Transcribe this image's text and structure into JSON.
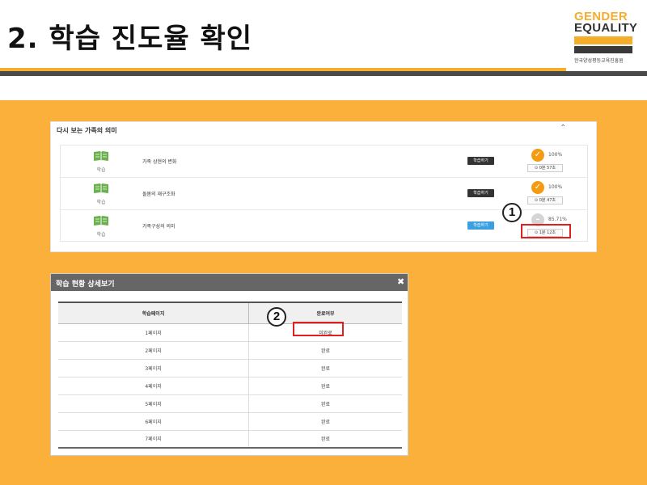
{
  "slide": {
    "title": "2. 학습 진도율 확인"
  },
  "logo": {
    "line1": "GENDER",
    "line2": "EQUALITY",
    "org": "한국양성평등교육진흥원"
  },
  "colors": {
    "accent": "#fbb03b",
    "dark_bar": "#4a4a4a",
    "check": "#f39c12",
    "study_button_dark": "#333333",
    "study_button_active": "#3aa0e0",
    "highlight_box": "#e02020"
  },
  "panel": {
    "title": "다시 보는 가족의 의미",
    "toggle_icon": "chevron-up-icon",
    "toggle_glyph": "⌃",
    "rows": [
      {
        "icon": "book-icon",
        "label": "학습",
        "title": "가족 상현의 변화",
        "button_label": "학습하기",
        "button_style": "dark",
        "status": "complete",
        "status_glyph": "✓",
        "percent": "100%",
        "time": "0분 57초"
      },
      {
        "icon": "book-icon",
        "label": "학습",
        "title": "돌봄의 재구조화",
        "button_label": "학습하기",
        "button_style": "dark",
        "status": "complete",
        "status_glyph": "✓",
        "percent": "100%",
        "time": "0분 47초"
      },
      {
        "icon": "book-icon",
        "label": "학습",
        "title": "가족구성의 의미",
        "button_label": "학습하기",
        "button_style": "active",
        "status": "incomplete",
        "status_glyph": "–",
        "percent": "85.71%",
        "time": "1분 12초"
      }
    ],
    "clock_glyph": "⊙"
  },
  "annotations": {
    "marker1": "1",
    "marker2": "2"
  },
  "modal": {
    "title": "학습 현황 상세보기",
    "close_glyph": "✖",
    "columns": [
      "학습페이지",
      "완료여부"
    ],
    "rows": [
      [
        "1페이지",
        "미완료"
      ],
      [
        "2페이지",
        "완료"
      ],
      [
        "3페이지",
        "완료"
      ],
      [
        "4페이지",
        "완료"
      ],
      [
        "5페이지",
        "완료"
      ],
      [
        "6페이지",
        "완료"
      ],
      [
        "7페이지",
        "완료"
      ]
    ]
  }
}
